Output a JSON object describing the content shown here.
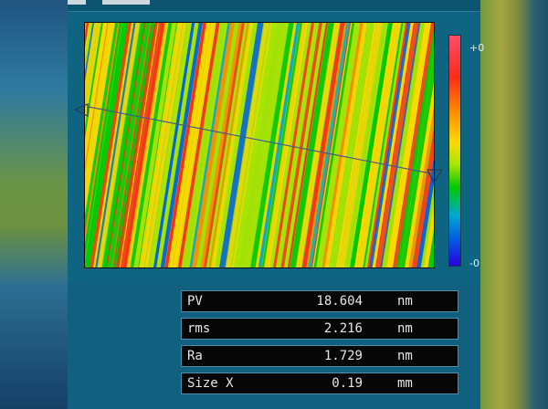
{
  "colors": {
    "window_bg": "#11607f",
    "row_bg": "#060606",
    "row_text": "#e6e6e6",
    "stripe_palette": [
      "#ff2a1a",
      "#ff8a00",
      "#ffd800",
      "#a8e600",
      "#00c800",
      "#00a8d0",
      "#0060e0"
    ]
  },
  "colorbar": {
    "top_label": "+0",
    "bottom_label": "-0"
  },
  "surface_map": {
    "icons": [
      "start-marker-triangle-icon",
      "end-marker-triangle-icon"
    ]
  },
  "stats": [
    {
      "label": "PV",
      "value": "18.604",
      "unit": "nm"
    },
    {
      "label": "rms",
      "value": "2.216",
      "unit": "nm"
    },
    {
      "label": "Ra",
      "value": "1.729",
      "unit": "nm"
    },
    {
      "label": "Size X",
      "value": "0.19",
      "unit": "mm"
    }
  ]
}
